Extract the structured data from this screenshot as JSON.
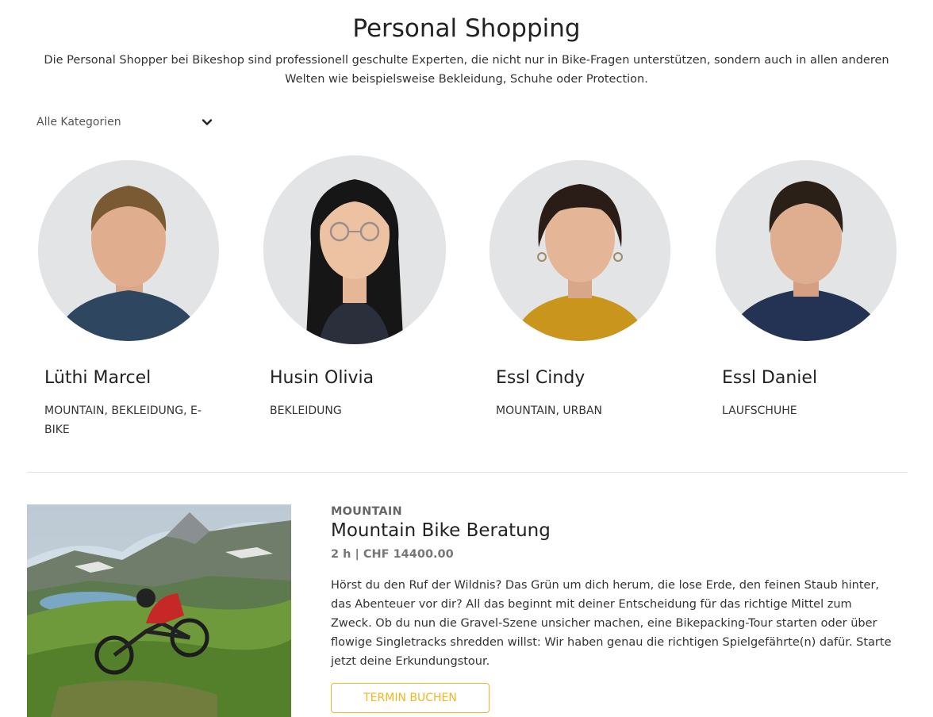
{
  "header": {
    "title": "Personal Shopping",
    "intro": "Die Personal Shopper bei Bikeshop sind professionell geschulte Experten, die nicht nur in Bike-Fragen unterstützen, sondern auch in allen anderen Welten wie beispielsweise Bekleidung, Schuhe oder Protection."
  },
  "filter": {
    "selected": "Alle Kategorien",
    "icon": "chevron-down-icon"
  },
  "shoppers": [
    {
      "name": "Lüthi Marcel",
      "tags": "MOUNTAIN, BEKLEIDUNG, E-BIKE",
      "shirt_color": "#2e4660",
      "hair_color": "#7a5a32"
    },
    {
      "name": "Husin Olivia",
      "tags": "BEKLEIDUNG",
      "shirt_color": "#2b2f3c",
      "hair_color": "#161616"
    },
    {
      "name": "Essl Cindy",
      "tags": "MOUNTAIN, URBAN",
      "shirt_color": "#c9951c",
      "hair_color": "#2a1d17"
    },
    {
      "name": "Essl Daniel",
      "tags": "LAUFSCHUHE",
      "shirt_color": "#243353",
      "hair_color": "#2a2018"
    }
  ],
  "service": {
    "category": "MOUNTAIN",
    "title": "Mountain Bike Beratung",
    "meta": "2 h | CHF 14400.00",
    "description": "Hörst du den Ruf der Wildnis? Das Grün um dich herum, die lose Erde, den feinen Staub hinter, das Abenteuer vor dir? All das beginnt mit deiner Entscheidung für das richtige Mittel zum Zweck. Ob du nun die Gravel-Szene unsicher machen, eine Bikepacking-Tour starten oder über flowige Singletracks shredden willst: Wir haben genau die richtigen Spielgefährte(n) dafür. Starte jetzt deine Erkundungstour.",
    "button_label": "TERMIN BUCHEN",
    "accent_color": "#f0b722"
  }
}
